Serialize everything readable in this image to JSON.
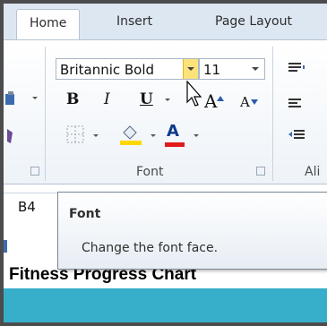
{
  "ribbon": {
    "tabs": [
      {
        "label": "Home"
      },
      {
        "label": "Insert"
      },
      {
        "label": "Page Layout"
      }
    ],
    "font_group": {
      "font_name": "Britannic Bold",
      "font_size": "11",
      "bold": "B",
      "italic": "I",
      "underline": "U",
      "grow": "A",
      "shrink": "A",
      "font_color": "A",
      "label": "Font"
    },
    "alignment_label_partial": "Ali"
  },
  "formula_bar": {
    "name_box": "B4"
  },
  "tooltip": {
    "title": "Font",
    "description": "Change the font face."
  },
  "sheet": {
    "title_cell": "Fitness Progress Chart"
  },
  "colors": {
    "tooltip_accent": "#fbe37a",
    "highlight_fill": "#ffd800",
    "font_color_bar": "#e01b1b",
    "sheet_band": "#37aeca"
  }
}
